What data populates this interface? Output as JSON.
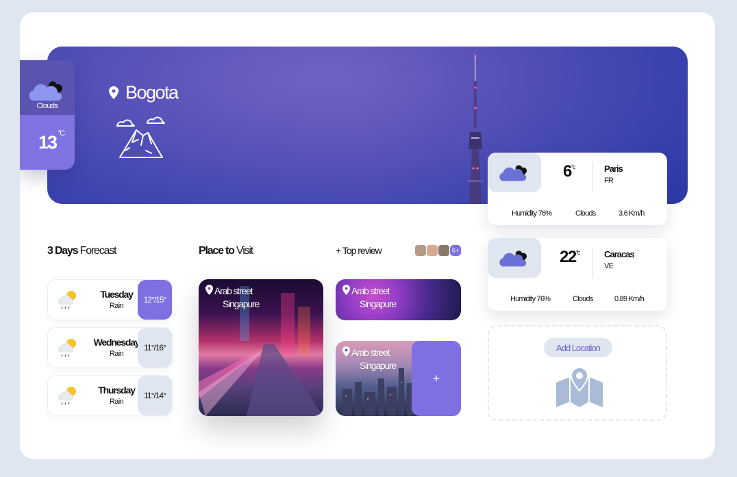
{
  "hero": {
    "city": "Bogota",
    "current": {
      "condition": "Clouds",
      "temp": "13",
      "unit": "°C"
    }
  },
  "forecast": {
    "title_bold": "3 Days",
    "title_rest": "Forecast",
    "days": [
      {
        "day": "Tuesday",
        "condition": "Rain",
        "range": "12°/15°",
        "active": true
      },
      {
        "day": "Wednesday",
        "condition": "Rain",
        "range": "11°/16°",
        "active": false
      },
      {
        "day": "Thursday",
        "condition": "Rain",
        "range": "11°/14°",
        "active": false
      }
    ]
  },
  "places": {
    "title_bold": "Place to",
    "title_rest": "Visit",
    "top_review": "+ Top review",
    "more_count": "6+",
    "add_label": "+",
    "items": [
      {
        "line1": "Arab street",
        "line2": "Singapure"
      },
      {
        "line1": "Arab street",
        "line2": "Singapure"
      },
      {
        "line1": "Arab street",
        "line2": "Singapure"
      }
    ]
  },
  "cities": [
    {
      "temp": "6",
      "unit": "°c",
      "city": "Paris",
      "country": "FR",
      "humidity": "Humidity 76%",
      "condition": "Clouds",
      "wind": "3.6 Km/h"
    },
    {
      "temp": "22",
      "unit": "°c",
      "city": "Caracas",
      "country": "VE",
      "humidity": "Humidity 76%",
      "condition": "Clouds",
      "wind": "0.89 Km/h"
    }
  ],
  "add_location": {
    "label": "Add Location"
  },
  "colors": {
    "accent": "#7e6fe3",
    "hero": "#4a4fb6",
    "panel": "#dfe6ef",
    "cloud": "#6b72d6"
  }
}
